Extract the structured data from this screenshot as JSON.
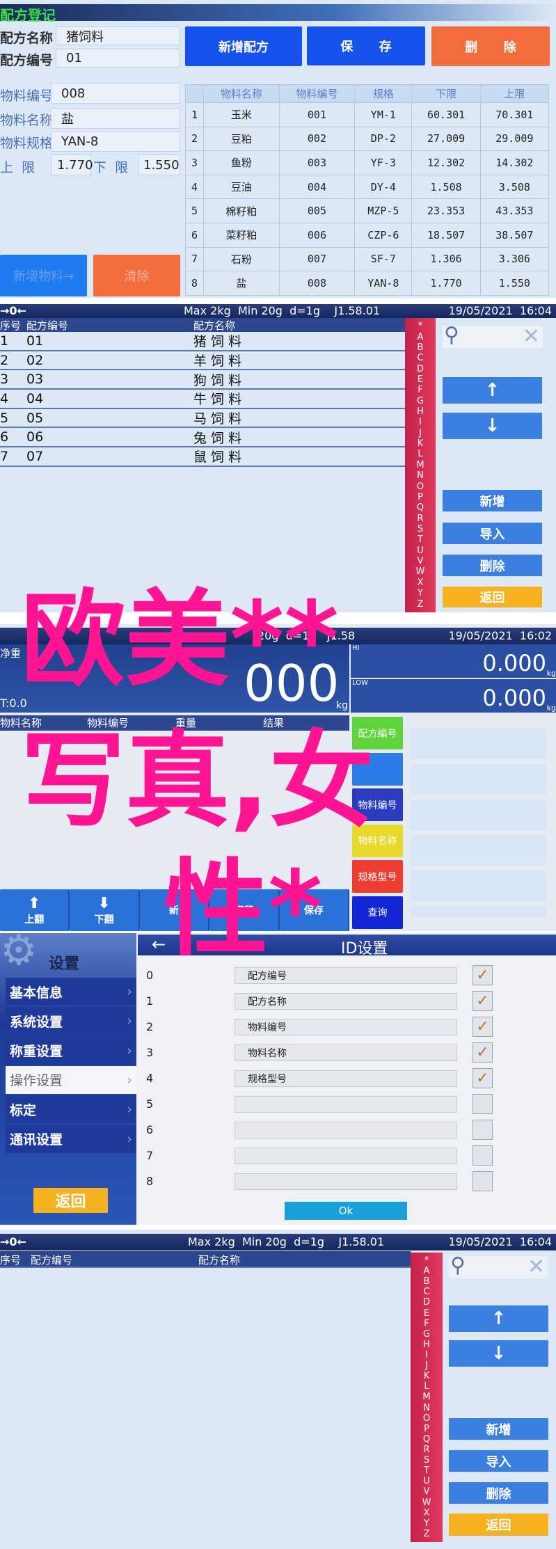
{
  "recipe_register": {
    "title": "配方登记",
    "recipe_name_label": "配方名称",
    "recipe_name": "猪饲料",
    "recipe_code_label": "配方编号",
    "recipe_code": "01",
    "new_recipe": "新增配方",
    "save": "保      存",
    "delete": "删      除",
    "material_code_label": "物料编号",
    "material_code": "008",
    "material_name_label": "物料名称",
    "material_name": "盐",
    "material_spec_label": "物料规格",
    "material_spec": "YAN-8",
    "upper_label": "上  限",
    "upper": "1.770",
    "lower_label": "下  限",
    "lower": "1.550",
    "add_material": "新增物料→",
    "clear": "清除",
    "table": {
      "headers": [
        "",
        "物料名称",
        "物料编号",
        "规格",
        "下限",
        "上限"
      ],
      "rows": [
        [
          "1",
          "玉米",
          "001",
          "YM-1",
          "60.301",
          "70.301"
        ],
        [
          "2",
          "豆粕",
          "002",
          "DP-2",
          "27.009",
          "29.009"
        ],
        [
          "3",
          "鱼粉",
          "003",
          "YF-3",
          "12.302",
          "14.302"
        ],
        [
          "4",
          "豆油",
          "004",
          "DY-4",
          "1.508",
          "3.508"
        ],
        [
          "5",
          "棉籽粕",
          "005",
          "MZP-5",
          "23.353",
          "43.353"
        ],
        [
          "6",
          "菜籽粕",
          "006",
          "CZP-6",
          "18.507",
          "38.507"
        ],
        [
          "7",
          "石粉",
          "007",
          "SF-7",
          "1.306",
          "3.306"
        ],
        [
          "8",
          "盐",
          "008",
          "YAN-8",
          "1.770",
          "1.550"
        ]
      ]
    }
  },
  "recipe_list": {
    "zero_icon": "→0←",
    "spec": "Max 2kg  Min 20g  d=1g    J1.58.01",
    "datetime": "19/05/2021  16:04",
    "headers": [
      "序号",
      "配方编号",
      "配方名称"
    ],
    "rows": [
      [
        "1",
        "01",
        "猪 饲 料"
      ],
      [
        "2",
        "02",
        "羊 饲 料"
      ],
      [
        "3",
        "03",
        "狗 饲 料"
      ],
      [
        "4",
        "04",
        "牛 饲 料"
      ],
      [
        "5",
        "05",
        "马 饲 料"
      ],
      [
        "6",
        "06",
        "兔 饲 料"
      ],
      [
        "7",
        "07",
        "鼠 饲 料"
      ]
    ],
    "alphabet": [
      "*",
      "A",
      "B",
      "C",
      "D",
      "E",
      "F",
      "G",
      "H",
      "I",
      "J",
      "K",
      "L",
      "M",
      "N",
      "O",
      "P",
      "Q",
      "R",
      "S",
      "T",
      "U",
      "V",
      "W",
      "X",
      "Y",
      "Z"
    ],
    "up": "↑",
    "down": "↓",
    "add": "新增",
    "import": "导入",
    "delete": "删除",
    "back": "返回"
  },
  "weighing": {
    "spec": "20g  d=1g   J1.58",
    "datetime": "19/05/2021  16:02",
    "net_label": "净重",
    "net_value": "000",
    "net_unit": "kg",
    "tare": "T:0.0",
    "hi_label": "HI",
    "hi_value": "0.000",
    "lo_label": "LOW",
    "lo_value": "0.000",
    "unit": "kg",
    "headers": [
      "物料名称",
      "物料编号",
      "重量",
      "结果"
    ],
    "side_buttons": [
      {
        "label": "配方编号",
        "color": "#5fd33c"
      },
      {
        "label": "",
        "color": "#2e7ce8"
      },
      {
        "label": "物料编号",
        "color": "#2b3cc0"
      },
      {
        "label": "物料名称",
        "color": "#e6d92a"
      },
      {
        "label": "规格型号",
        "color": "#ee3c30"
      },
      {
        "label": "查询",
        "color": "#1226d6"
      }
    ],
    "toolbar": [
      {
        "icon": "⬆",
        "label": "上翻"
      },
      {
        "icon": "⬇",
        "label": "下翻"
      },
      {
        "icon": "",
        "label": "新"
      },
      {
        "icon": "",
        "label": "打印"
      },
      {
        "icon": "",
        "label": "保存"
      }
    ]
  },
  "settings": {
    "title": "设置",
    "menu": [
      "基本信息",
      "系统设置",
      "称重设置",
      "操作设置",
      "标定",
      "通讯设置"
    ],
    "selected": 3,
    "back": "返回",
    "page_title": "ID设置",
    "ids": [
      {
        "i": "0",
        "name": "配方编号",
        "on": true
      },
      {
        "i": "1",
        "name": "配方名称",
        "on": true
      },
      {
        "i": "2",
        "name": "物料编号",
        "on": true
      },
      {
        "i": "3",
        "name": "物料名称",
        "on": true
      },
      {
        "i": "4",
        "name": "规格型号",
        "on": true
      },
      {
        "i": "5",
        "name": "",
        "on": false
      },
      {
        "i": "6",
        "name": "",
        "on": false
      },
      {
        "i": "7",
        "name": "",
        "on": false
      },
      {
        "i": "8",
        "name": "",
        "on": false
      }
    ],
    "ok": "Ok"
  },
  "recipe_list_empty": {
    "zero_icon": "→0←",
    "spec": "Max 2kg  Min 20g  d=1g    J1.58.01",
    "datetime": "19/05/2021  16:04",
    "headers": [
      "序号",
      "配方编号",
      "配方名称"
    ]
  },
  "watermark": [
    "欧美**",
    "写真,女",
    "性*"
  ]
}
